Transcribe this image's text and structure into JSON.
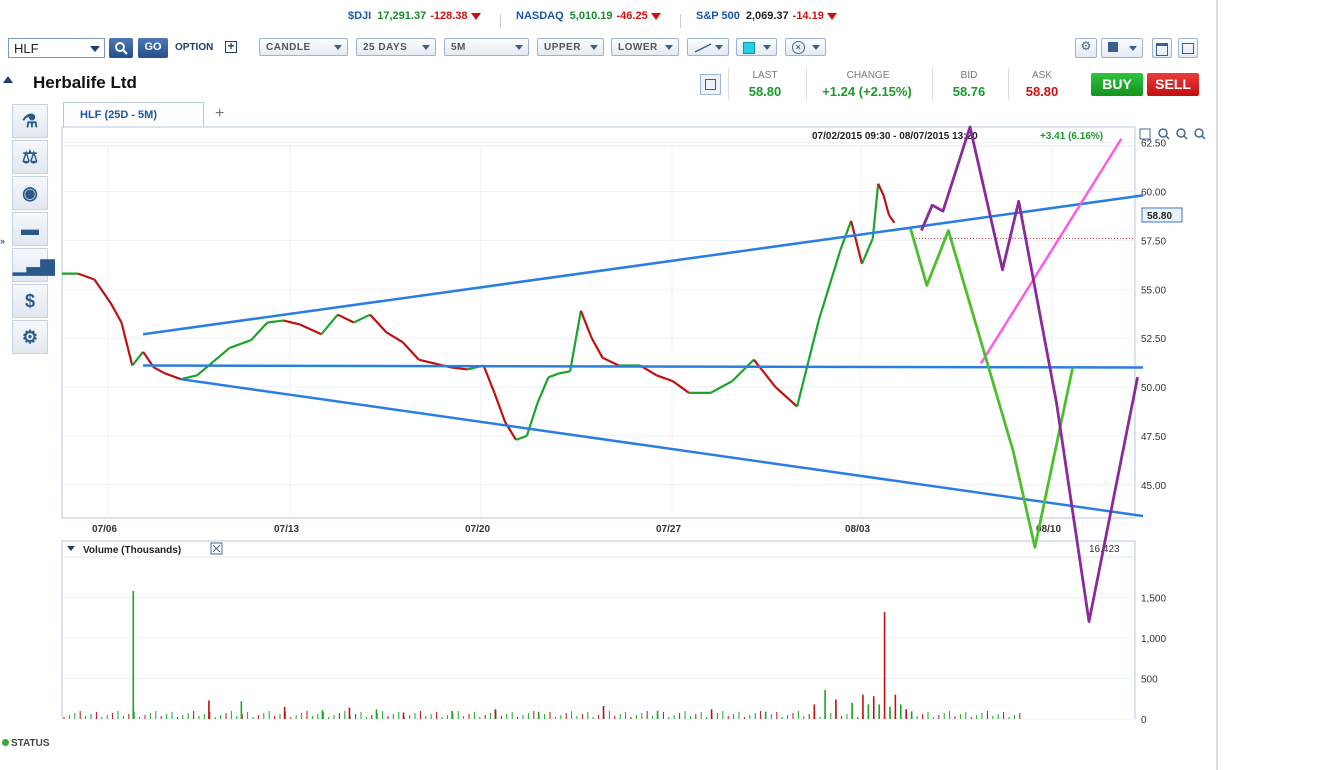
{
  "ticker": [
    {
      "symbol": "$DJI",
      "value": "17,291.37",
      "change": "-128.38",
      "value_color": "green"
    },
    {
      "symbol": "NASDAQ",
      "value": "5,010.19",
      "change": "-46.25",
      "value_color": "green"
    },
    {
      "symbol": "S&P 500",
      "value": "2,069.37",
      "change": "-14.19",
      "value_color": "black"
    }
  ],
  "toolbar": {
    "symbol": "HLF",
    "go_label": "GO",
    "option_label": "OPTION",
    "chart_type": "CANDLE",
    "period": "25 DAYS",
    "interval": "5M",
    "upper": "UPPER",
    "lower": "LOWER"
  },
  "header": {
    "company": "Herbalife Ltd",
    "last_label": "LAST",
    "last": "58.80",
    "change_label": "CHANGE",
    "change": "+1.24 (+2.15%)",
    "bid_label": "BID",
    "bid": "58.76",
    "ask_label": "ASK",
    "ask": "58.80",
    "buy_label": "BUY",
    "sell_label": "SELL"
  },
  "sidebar": {
    "icons": [
      "microscope-icon",
      "scale-icon",
      "eye-icon",
      "briefcase-icon",
      "bar-chart-icon",
      "dollar-icon",
      "gear-icon"
    ]
  },
  "chart_tab": {
    "label": "HLF (25D - 5M)",
    "add": "+"
  },
  "status_label": "STATUS",
  "chart_data": [
    {
      "type": "line",
      "range_text": "07/02/2015 09:30 - 08/07/2015 13:20",
      "range_change": "+3.41 (6.16%)",
      "price_tag": "58.80",
      "x_ticks": [
        "07/06",
        "07/13",
        "07/20",
        "07/27",
        "08/03",
        "08/10"
      ],
      "y_ticks": [
        "62.50",
        "60.00",
        "57.50",
        "55.00",
        "52.50",
        "50.00",
        "47.50",
        "45.00"
      ],
      "ylim": [
        43.3,
        63.3
      ],
      "x": [
        0,
        3,
        6,
        9,
        11,
        13,
        15,
        17,
        19,
        22,
        25,
        28,
        31,
        35,
        38,
        41,
        44,
        48,
        51,
        54,
        57,
        60,
        63,
        66,
        69,
        72,
        75,
        78,
        80,
        82,
        84,
        86,
        88,
        90,
        92,
        94,
        96,
        98,
        100,
        103,
        107,
        110,
        113,
        116,
        120,
        124,
        128,
        132,
        136,
        140,
        144,
        146,
        148,
        150,
        151,
        152,
        153,
        154,
        155,
        156,
        157,
        158,
        159,
        160,
        161,
        162,
        163
      ],
      "close": [
        55.8,
        55.8,
        55.5,
        54.3,
        53.3,
        51.1,
        51.8,
        51.0,
        50.7,
        50.4,
        50.6,
        51.3,
        52.0,
        52.4,
        53.3,
        53.4,
        53.2,
        52.7,
        53.7,
        53.3,
        53.7,
        52.8,
        52.3,
        51.4,
        51.2,
        51.0,
        50.9,
        51.1,
        49.7,
        48.2,
        47.3,
        47.5,
        49.2,
        50.5,
        50.7,
        50.8,
        53.9,
        52.5,
        51.5,
        51.1,
        51.1,
        50.6,
        50.3,
        49.7,
        49.7,
        50.3,
        51.4,
        50.0,
        49.0,
        53.4,
        57.0,
        58.5,
        56.3,
        57.6,
        60.4,
        59.8,
        58.8,
        58.4,
        null,
        null,
        null,
        null,
        null,
        null,
        null,
        null,
        null
      ],
      "trendlines": [
        {
          "color": "#2a7de1",
          "points": [
            [
              15,
              52.7
            ],
            [
              200,
              59.8
            ]
          ]
        },
        {
          "color": "#2a7de1",
          "points": [
            [
              15,
              51.1
            ],
            [
              200,
              51.0
            ]
          ]
        },
        {
          "color": "#2a7de1",
          "points": [
            [
              22,
              50.4
            ],
            [
              200,
              43.4
            ]
          ]
        },
        {
          "color": "#ff5ae6",
          "points": [
            [
              170,
              51.2
            ],
            [
              196,
              62.7
            ]
          ]
        }
      ],
      "projections": [
        {
          "color": "#4cbf2c",
          "points": [
            [
              157,
              58.1
            ],
            [
              160,
              55.2
            ],
            [
              164,
              58.0
            ],
            [
              176,
              46.7
            ],
            [
              180,
              41.8
            ],
            [
              187,
              51.0
            ]
          ]
        },
        {
          "color": "#8a2a9c",
          "points": [
            [
              159,
              58.0
            ],
            [
              161,
              59.3
            ],
            [
              163,
              59.0
            ],
            [
              168,
              63.3
            ],
            [
              174,
              56.0
            ],
            [
              177,
              59.5
            ],
            [
              184,
              49.2
            ],
            [
              190,
              38.0
            ],
            [
              199,
              50.5
            ]
          ]
        }
      ]
    },
    {
      "type": "bar",
      "title": "Volume (Thousands)",
      "last_value": "16,423",
      "y_ticks": [
        "1,500",
        "1,000",
        "500",
        "0"
      ],
      "ylim": [
        0,
        2000
      ],
      "x": [
        13,
        27,
        33,
        41,
        48,
        53,
        58,
        63,
        72,
        80,
        88,
        100,
        110,
        120,
        130,
        139,
        141,
        143,
        146,
        148,
        149,
        150,
        151,
        152,
        153,
        154,
        155,
        156,
        157
      ],
      "values": [
        1580,
        230,
        220,
        150,
        110,
        140,
        120,
        80,
        100,
        120,
        90,
        160,
        100,
        120,
        90,
        180,
        360,
        240,
        200,
        300,
        180,
        280,
        180,
        1320,
        150,
        300,
        180,
        120,
        90
      ]
    }
  ]
}
